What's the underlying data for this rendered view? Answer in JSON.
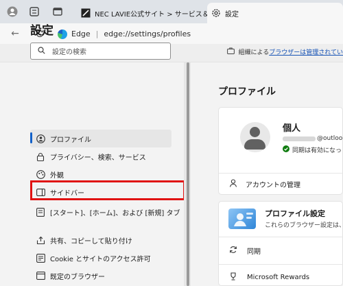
{
  "tabs": {
    "inactive": {
      "title": "NEC LAVIE公式サイト > サービス＆サ"
    },
    "active": {
      "title": "設定"
    }
  },
  "addressbar": {
    "label": "Edge",
    "separator": "|",
    "url": "edge://settings/profiles"
  },
  "banner": {
    "prefix": "組織による",
    "link": "ブラウザーは管理されてい"
  },
  "sidebar": {
    "title": "設定",
    "search_placeholder": "設定の検索",
    "items": [
      {
        "label": "プロファイル",
        "icon": "profile-icon"
      },
      {
        "label": "プライバシー、検索、サービス",
        "icon": "lock-icon"
      },
      {
        "label": "外観",
        "icon": "appearance-icon"
      },
      {
        "label": "サイドバー",
        "icon": "sidebar-icon"
      },
      {
        "label": "[スタート]、[ホーム]、および [新規] タブ",
        "icon": "tab-icon"
      },
      {
        "label": "共有、コピーして貼り付け",
        "icon": "share-icon"
      },
      {
        "label": "Cookie とサイトのアクセス許可",
        "icon": "cookie-icon"
      },
      {
        "label": "既定のブラウザー",
        "icon": "browser-icon"
      }
    ]
  },
  "main": {
    "title": "プロファイル",
    "profile": {
      "name": "個人",
      "email": "@outlook",
      "sync_status": "同期は有効になっ"
    },
    "account_manage": "アカウントの管理",
    "profile_settings": {
      "title": "プロファイル設定",
      "desc": "これらのブラウザー設定は、Mic"
    },
    "sync": "同期",
    "rewards": "Microsoft Rewards"
  },
  "colors": {
    "accent": "#1160c8",
    "highlight": "#e01212",
    "link": "#1552b5",
    "sync_ok": "#107c10"
  }
}
